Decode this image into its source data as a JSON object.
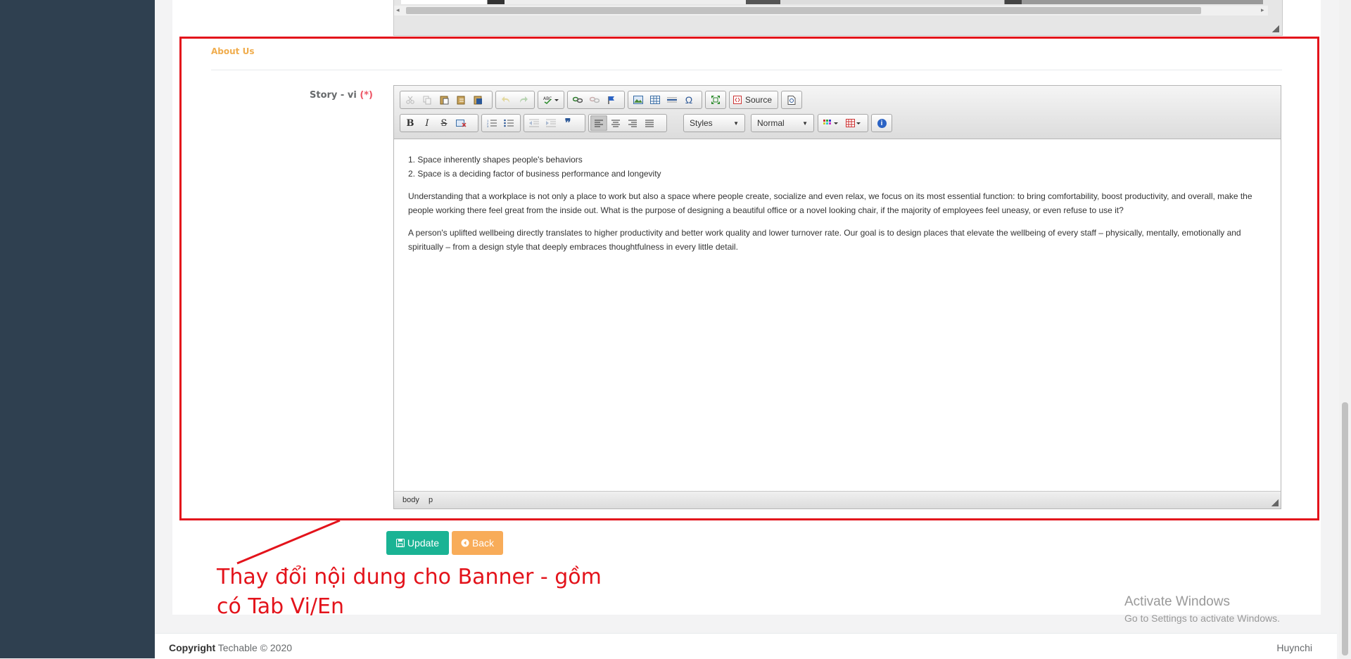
{
  "prev_editor": {
    "scroll_left_arrow": "◂",
    "scroll_right_arrow": "▸"
  },
  "section": {
    "title": "About Us"
  },
  "field": {
    "label": "Story - vi",
    "required": "(*)"
  },
  "toolbar": {
    "source_label": "Source",
    "styles_label": "Styles",
    "format_label": "Normal",
    "icons": {
      "cut": "cut-icon",
      "copy": "copy-icon",
      "paste": "paste-icon",
      "paste_text": "paste-text-icon",
      "paste_word": "paste-word-icon",
      "undo": "undo-icon",
      "redo": "redo-icon",
      "spellcheck": "spellcheck-icon",
      "link": "link-icon",
      "unlink": "unlink-icon",
      "anchor": "anchor-icon",
      "image": "image-icon",
      "table": "table-icon",
      "hr": "horizontal-rule-icon",
      "special_char": "special-char-icon",
      "maximize": "maximize-icon",
      "source": "source-icon",
      "preview": "preview-icon",
      "bold": "bold-icon",
      "italic": "italic-icon",
      "strike": "strike-icon",
      "remove_format": "remove-format-icon",
      "numbered_list": "numbered-list-icon",
      "bulleted_list": "bulleted-list-icon",
      "outdent": "outdent-icon",
      "indent": "indent-icon",
      "blockquote": "blockquote-icon",
      "align_left": "align-left-icon",
      "align_center": "align-center-icon",
      "align_right": "align-right-icon",
      "justify": "justify-icon",
      "text_color": "text-color-icon",
      "table_menu": "table-menu-icon",
      "about": "about-icon"
    },
    "glyphs": {
      "bold": "B",
      "italic": "I",
      "strike": "S",
      "special_char": "Ω",
      "blockquote": "❞",
      "about": "i"
    }
  },
  "content": {
    "list": [
      "1. Space inherently shapes people's behaviors",
      "2. Space is a deciding factor of business performance and longevity"
    ],
    "paragraphs": [
      "Understanding that a workplace is not only a place to work but also a space where people create, socialize and even relax, we focus on its most essential function: to bring comfortability, boost productivity, and overall, make the people working there feel great from the inside out. What is the purpose of designing a beautiful office or a novel looking chair, if the majority of employees feel uneasy, or even refuse to use it?",
      "A person's uplifted wellbeing directly translates to higher productivity and better work quality and lower turnover rate. Our goal is to design places that elevate the wellbeing of every staff – physically, mentally, emotionally and spiritually – from a design style that deeply embraces thoughtfulness in every little detail."
    ]
  },
  "pathbar": {
    "body": "body",
    "p": "p"
  },
  "buttons": {
    "update": "Update",
    "back": "Back",
    "update_icon": "save-icon",
    "back_icon": "back-circle-icon"
  },
  "annotation": {
    "line1": "Thay đổi nội dung cho Banner - gồm",
    "line2": "có Tab Vi/En",
    "color": "#e3131b"
  },
  "watermark": {
    "title": "Activate Windows",
    "subtitle": "Go to Settings to activate Windows."
  },
  "footer": {
    "copyright_label": "Copyright",
    "copyright_text": "Techable © 2020",
    "user": "Huynchi"
  },
  "colors": {
    "sidebar": "#2f4050",
    "primary": "#1ab394",
    "warning": "#f8ac59",
    "section_title": "#f0ad4e",
    "required": "#ed5565"
  }
}
